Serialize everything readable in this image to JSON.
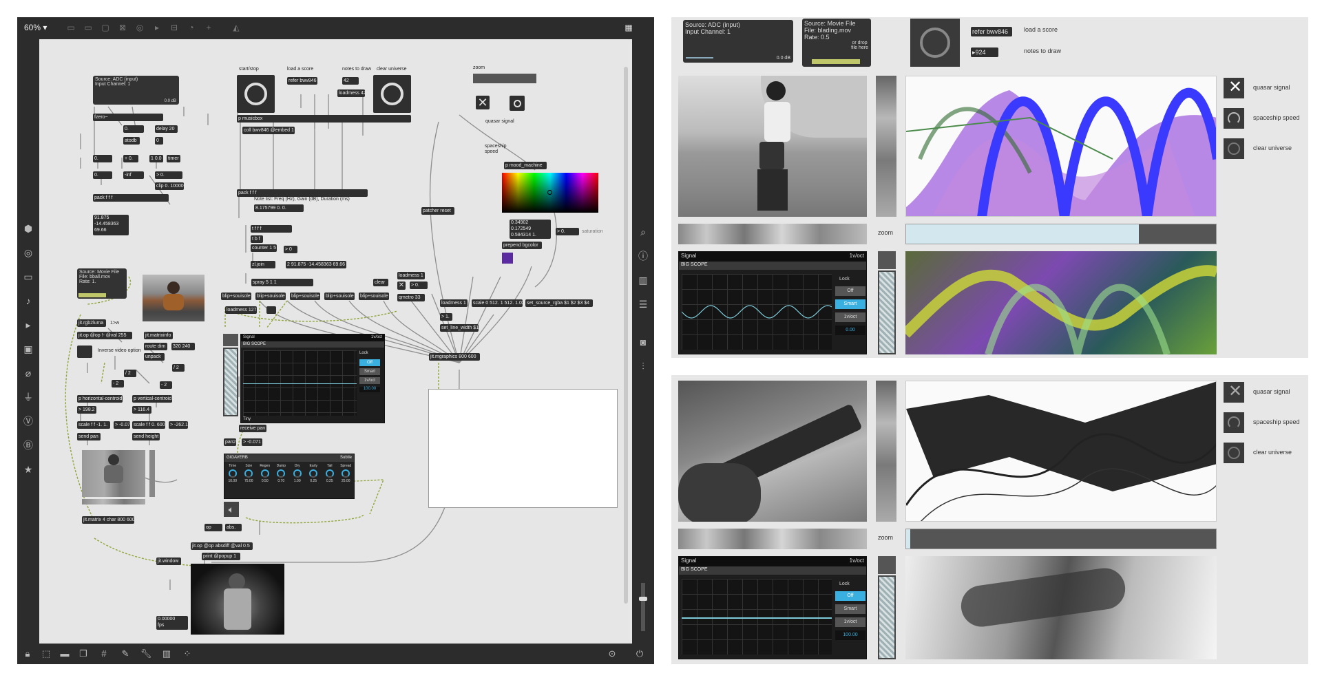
{
  "toolbar": {
    "zoom": "60% ▾"
  },
  "patch": {
    "labels": {
      "startstop": "start/stop",
      "loadscore": "load a score",
      "notes": "notes to draw",
      "clear": "clear universe",
      "zoom": "zoom",
      "quasar": "quasar signal",
      "spaceship": "spaceship\nspeed",
      "notelist": "Note list: Freq (Hz), Gain (dB), Duration (ms)",
      "invert": "Inverse video option",
      "saturation": "saturation"
    },
    "adc": {
      "title": "Source: ADC (input)",
      "channel": "Input Channel: 1",
      "db": "0.0 dB"
    },
    "movie": {
      "title": "Source: Movie File",
      "file": "File:  bball.mov",
      "rate": "Rate:  1.",
      "drop": "or drop file here"
    },
    "objects": {
      "fzero": "fzero~",
      "n0a": "0.",
      "delay": "delay 20",
      "atodb": "atodb",
      "n0b": "0",
      "n0c": "0.",
      "plus0": "+ 0.",
      "n100": "1 0.0",
      "timer": "timer",
      "n0d": "0.",
      "minf": "-inf",
      "gt0": "> 0.",
      "clip": "clip 0. 10000",
      "pack1": "pack f f f",
      "vals": "91.875\n-14.458363\n69.66",
      "refer": "refer bwv846",
      "n42": "42",
      "loadmess42": "loadmess 42",
      "musicbox": "p musicbox",
      "coll": "coll bwv846 @embed 1",
      "pack2": "pack f f f",
      "numbers": "8.175799 0. 0.",
      "ttt": "t f f f",
      "tbf": "t b f",
      "counter": "counter 1 5",
      "gt0b": "> 0",
      "join": "zl.join",
      "joinvals": "2 91.875 -14.458363 69.66",
      "spray": "spray 5 1 1",
      "blip1": "blip+souisole",
      "blip2": "blip+souisole",
      "blip3": "blip+souisole",
      "blip4": "blip+souisole",
      "blip5": "blip+souisole",
      "loadmess127": "loadmess 127",
      "clr": "clear",
      "loadmess1": "loadmess 1",
      "gt0c": "> 0.",
      "qmetro": "qmetro 33",
      "patcherreset": "patcher reset",
      "mood": "p mood_machine",
      "sat": "0.34902\n0.172549\n0.584314 1.",
      "satnum": "> 0.",
      "prepend": "prepend bgcolor",
      "loadmess1b": "loadmess 1",
      "scale1": "scale 0 512. 1 512. 1.02",
      "setsource": "set_source_rgba $1 $2 $3 $4",
      "gt1": "> 1.",
      "setline": "set_line_width $1",
      "mgraphics": "jit.mgraphics 800 600",
      "rgb2luma": "jit.rgb2luma",
      "gtw": "1>w",
      "jitop": "jit.op @op !- @val 255",
      "matrixinfo": "jit.matrixinfo",
      "routedim": "route dim",
      "dim": "320 240",
      "unpack": "unpack",
      "n2a": "/ 2",
      "n2b": "/ 2",
      "n2c": "- 2",
      "n2d": "- 2",
      "hcentroid": "p horizontal-centroid",
      "vcentroid": "p vertical-centroid",
      "v198": "> 198.2",
      "v116": "> 116.4",
      "scale1f": "scale f f -1. 1.",
      "scale2f": "scale f f 0. 600.",
      "v071": "> -0.071",
      "v262": "> -262.1",
      "sendpan": "send pan",
      "sendheight": "send height",
      "receivepan": "receive pan",
      "v071b": "> -0.071",
      "pan2": "pan2",
      "matrix4": "jit.matrix 4 char 800 600",
      "op": "op",
      "abs": "abs.",
      "absdiff": "jit.op @op absdiff @val 0.5",
      "window": "jit.window",
      "print": "print @popup 1",
      "fps": "0.00000\nfps"
    },
    "scope": {
      "title": "Signal",
      "mode": "1v/oct",
      "sub": "BIG SCOPE",
      "lock": "Lock",
      "off": "Off",
      "smart": "Smart",
      "vo": "1v/oct",
      "value": "100.00",
      "foot": "Tiny"
    },
    "reverb": {
      "title": "GIGAVERB",
      "preset": "Subtle",
      "knobs": [
        "Time",
        "Size",
        "Regen",
        "Damp",
        "Dry",
        "Early",
        "Tail",
        "Spread"
      ],
      "vals": [
        "10.00",
        "75.00",
        "0.50",
        "0.70",
        "1.00",
        "0.25",
        "0.25",
        "25.00"
      ]
    }
  },
  "present": {
    "adc": {
      "title": "Source: ADC (input)",
      "channel": "Input Channel: 1",
      "db": "0.0 dB"
    },
    "movie": {
      "title": "Source: Movie File",
      "file": "File:  blading.mov",
      "rate": "Rate:  0.5",
      "drop": "or drop\nfile here"
    },
    "refer": "refer bwv846",
    "loadscore": "load a score",
    "notes_num": "▸924",
    "notes": "notes to draw",
    "zoom": "zoom",
    "zoom2": "zoom",
    "buttons": [
      "quasar signal",
      "spaceship speed",
      "clear universe"
    ],
    "buttons2": [
      "quasar signal",
      "spaceship speed",
      "clear universe"
    ],
    "scope": {
      "title": "Signal",
      "mode": "1v/oct",
      "sub": "BIG SCOPE",
      "lock": "Lock",
      "off": "Off",
      "smart": "Smart",
      "vo": "1v/oct",
      "value": "0.00",
      "value2": "100.00"
    }
  }
}
